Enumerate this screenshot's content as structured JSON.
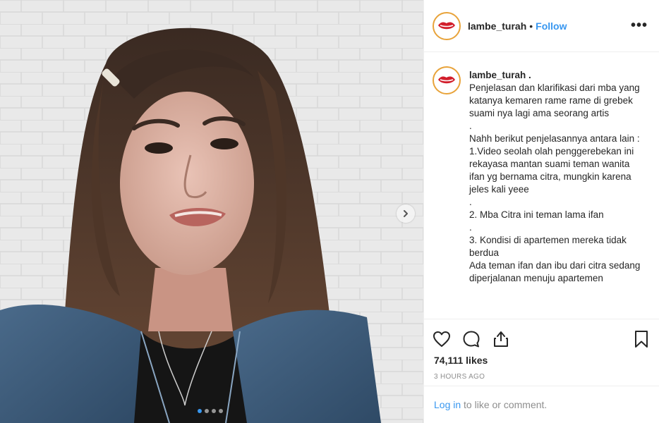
{
  "header": {
    "username": "lambe_turah",
    "separator": "•",
    "follow_label": "Follow",
    "more_label": "•••"
  },
  "caption": {
    "username": "lambe_turah .",
    "lines": [
      "Penjelasan dan klarifikasi dari mba yang katanya kemaren rame rame di grebek suami nya lagi ama seorang artis",
      ".",
      "Nahh berikut penjelasannya antara lain :",
      "1.Video seolah olah penggerebekan ini rekayasa mantan suami teman wanita ifan yg bernama citra, mungkin karena jeles kali yeee",
      ".",
      "2. Mba Citra ini teman lama ifan",
      ".",
      "3. Kondisi di apartemen mereka tidak berdua",
      "Ada teman ifan dan ibu dari citra sedang diperjalanan menuju apartemen"
    ]
  },
  "stats": {
    "likes": "74,111 likes",
    "time": "3 HOURS AGO"
  },
  "login": {
    "link_label": "Log in",
    "rest_text": " to like or comment."
  },
  "carousel": {
    "dot_count": 4,
    "active_index": 0
  },
  "icons": {
    "like": "heart-icon",
    "comment": "comment-icon",
    "share": "share-icon",
    "save": "bookmark-icon",
    "next": "chevron-right-icon"
  },
  "colors": {
    "accent": "#3897f0",
    "text": "#262626",
    "muted": "#8e8e8e",
    "border": "#efefef",
    "avatar_ring": "#e8a33a",
    "lips": "#d21e2b"
  }
}
